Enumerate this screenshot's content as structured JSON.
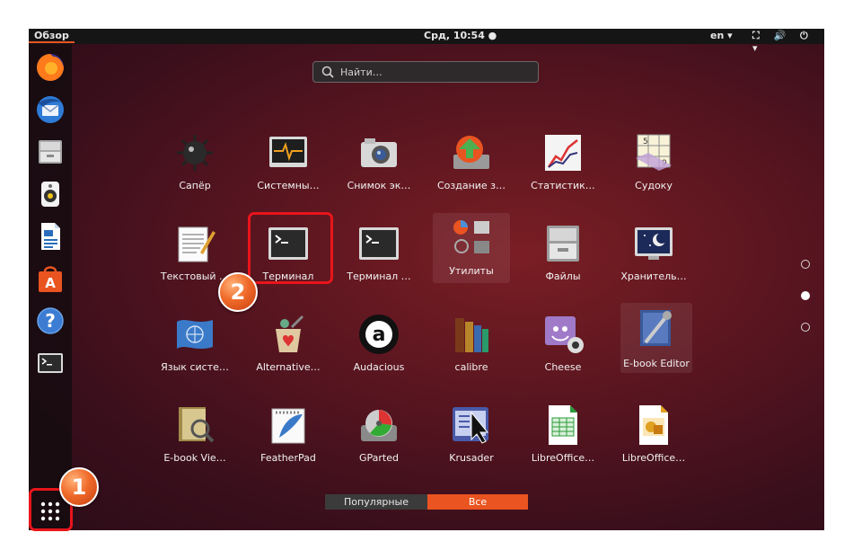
{
  "topbar": {
    "activities": "Обзор",
    "clock": "Срд, 10:54 ●",
    "lang": "en ▾",
    "tray": "⛶ 🔊 ⏻ ▾"
  },
  "search": {
    "placeholder": "Найти…"
  },
  "dock": {
    "items": [
      {
        "icon": "firefox-icon"
      },
      {
        "icon": "thunderbird-icon"
      },
      {
        "icon": "file-cabinet-icon"
      },
      {
        "icon": "speaker-icon"
      },
      {
        "icon": "writer-document-icon"
      },
      {
        "icon": "software-center-icon"
      },
      {
        "icon": "help-icon"
      },
      {
        "icon": "terminal-icon"
      }
    ],
    "show_apps_icon": "grid-icon"
  },
  "apps": {
    "row1": [
      "Сапёр",
      "Системны…",
      "Снимок эк…",
      "Создание з…",
      "Статистик…",
      "Судоку"
    ],
    "row2": [
      "Текстовый …",
      "Терминал",
      "Терминал …",
      "Утилиты",
      "Файлы",
      "Хранитель…"
    ],
    "row3": [
      "Язык систе…",
      "Alternative…",
      "Audacious",
      "calibre",
      "Cheese",
      "E-book Editor"
    ],
    "row4": [
      "E-book Vie…",
      "FeatherPad",
      "GParted",
      "Krusader",
      "LibreOffice…",
      "LibreOffice…"
    ]
  },
  "tabs": {
    "popular": "Популярные",
    "all": "Все"
  },
  "callouts": {
    "one": "1",
    "two": "2"
  },
  "colors": {
    "accent": "#e95420",
    "highlight": "#e8151b"
  }
}
